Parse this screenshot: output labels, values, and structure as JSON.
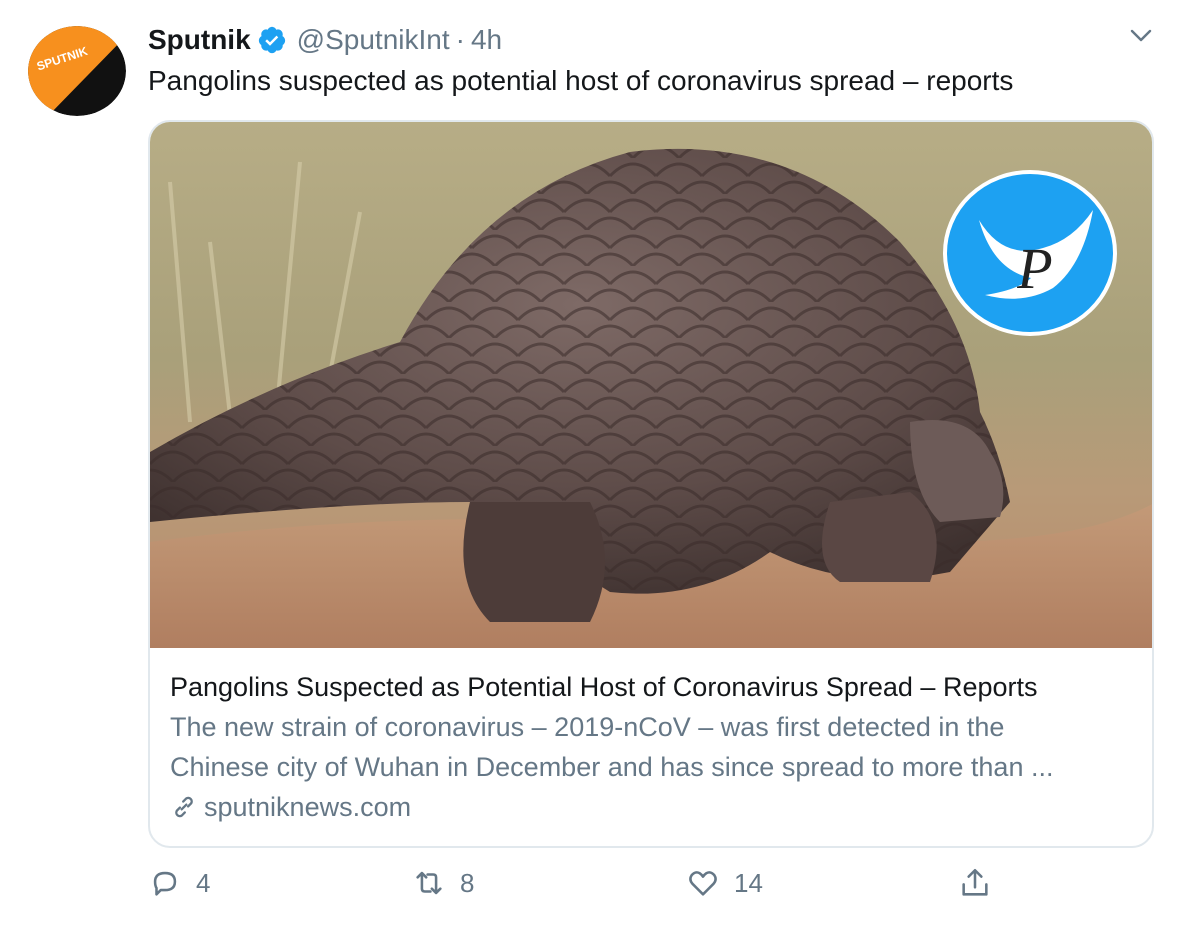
{
  "tweet": {
    "author_name": "Sputnik",
    "handle": "@SputnikInt",
    "separator": "·",
    "time": "4h",
    "text": "Pangolins suspected as potential host of coronavirus spread – reports",
    "avatar_label": "SPUTNIK"
  },
  "card": {
    "title": "Pangolins Suspected as Potential Host of Coronavirus Spread – Reports",
    "desc_line1": "The new strain of coronavirus – 2019-nCoV – was first detected in the",
    "desc_line2": "Chinese city of Wuhan in December and has since spread to more than ...",
    "domain": "sputniknews.com"
  },
  "actions": {
    "replies": "4",
    "retweets": "8",
    "likes": "14"
  },
  "colors": {
    "text_primary": "#14171a",
    "text_secondary": "#657786",
    "twitter_blue": "#1da1f2",
    "border": "#e1e8ed",
    "sputnik_orange": "#f7901e"
  },
  "icons": [
    "verified-badge-icon",
    "chevron-down-icon",
    "link-icon",
    "reply-icon",
    "retweet-icon",
    "like-icon",
    "share-icon"
  ]
}
